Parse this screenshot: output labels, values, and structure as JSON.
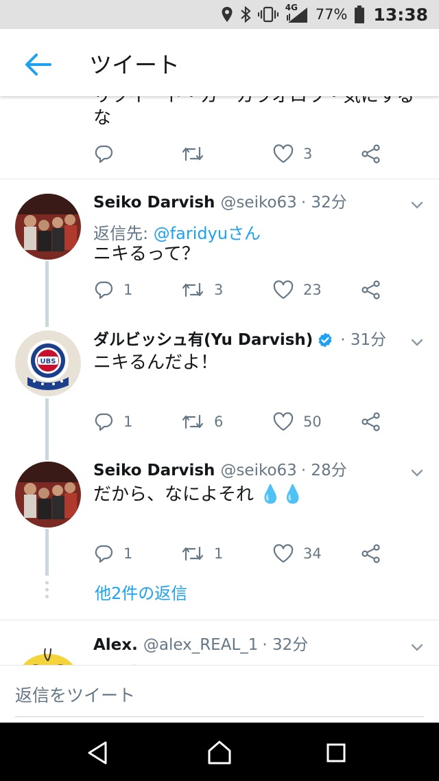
{
  "status_bar": {
    "network": "4G",
    "battery": "77%",
    "time": "13:38"
  },
  "app_bar": {
    "title": "ツイート"
  },
  "partial_tweet": {
    "text_line1": "リツイート・ガーカラオロワ・気にする",
    "text_line2": "な",
    "likes": "3"
  },
  "tweets": [
    {
      "name": "Seiko Darvish",
      "handle": "@seiko63",
      "time": "· 32分",
      "reply_label": "返信先: ",
      "reply_to": "@faridyuさん",
      "text": "ニキるって？",
      "replies": "1",
      "retweets": "3",
      "likes": "23"
    },
    {
      "name": "ダルビッシュ有(Yu Darvish)",
      "handle": "",
      "time": "· 31分",
      "text": "ニキるんだよ！",
      "replies": "1",
      "retweets": "6",
      "likes": "50"
    },
    {
      "name": "Seiko Darvish",
      "handle": "@seiko63",
      "time": "· 28分",
      "text": "だから、なによそれ 💧💧",
      "replies": "1",
      "retweets": "1",
      "likes": "34"
    },
    {
      "name": "Alex.",
      "handle": "@alex_REAL_1",
      "time": "· 32分",
      "text_partial": "返信先: @faridyuさん"
    }
  ],
  "more_replies": "他2件の返信",
  "composer": {
    "placeholder": "返信をツイート"
  },
  "icons": {
    "back": "arrow-left-icon",
    "reply": "comment-bubble-icon",
    "retweet": "retweet-icon",
    "like": "heart-icon",
    "share": "share-icon",
    "caret": "chevron-down-icon",
    "verified": "verified-badge-icon"
  },
  "colors": {
    "accent": "#1da1f2",
    "secondary_text": "#657786",
    "primary_text": "#14171a",
    "status_bar": "#e1e1e1",
    "nav_bar": "#000000"
  }
}
